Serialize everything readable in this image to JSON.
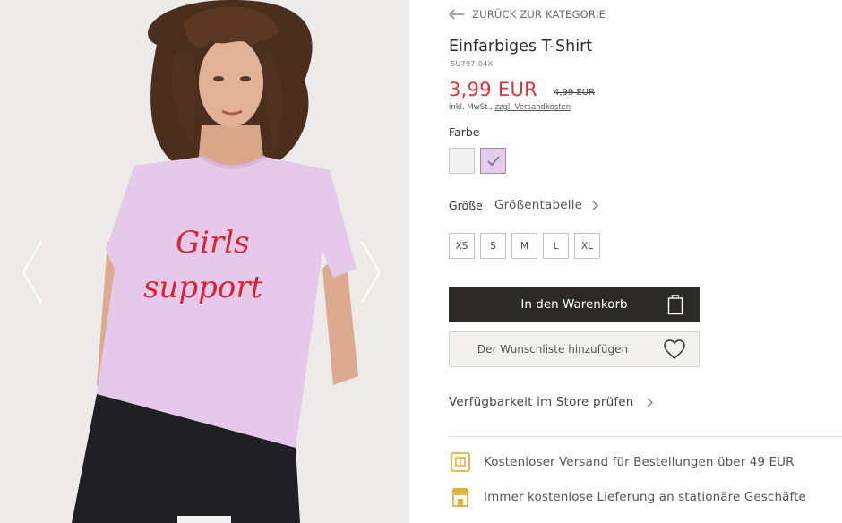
{
  "back_link": {
    "label": "ZURÜCK ZUR KATEGORIE"
  },
  "product": {
    "title": "Einfarbiges T-Shirt",
    "sku": "SU797-04X",
    "price": "3,99 EUR",
    "old_price": "4,99 EUR",
    "vat_prefix": "inkl. MwSt., ",
    "shipping_link": "zzgl. Versandkosten",
    "print_text": [
      "Girls",
      "support"
    ]
  },
  "color": {
    "label": "Farbe",
    "swatches": [
      {
        "name": "white",
        "hex": "#f1f1f1"
      },
      {
        "name": "pink",
        "hex": "#e3cdea",
        "selected": true
      }
    ]
  },
  "size": {
    "label": "Größe",
    "size_table_link": "Größentabelle",
    "options": [
      "XS",
      "S",
      "M",
      "L",
      "XL"
    ]
  },
  "actions": {
    "add_to_cart": "In den Warenkorb",
    "add_to_wishlist": "Der Wunschliste hinzufügen"
  },
  "availability": {
    "label": "Verfügbarkeit im Store prüfen"
  },
  "benefits": [
    {
      "icon": "delivery-box-icon",
      "text": "Kostenloser Versand für Bestellungen über 49 EUR"
    },
    {
      "icon": "store-icon",
      "text": "Immer kostenlose Lieferung an stationäre Geschäfte"
    }
  ],
  "colors": {
    "price_red": "#e0303a",
    "cart_button": "#2b2a29",
    "icon_gold": "#e2b13c",
    "shirt_pink": "#e6c8ea",
    "print_red": "#d6252f"
  }
}
